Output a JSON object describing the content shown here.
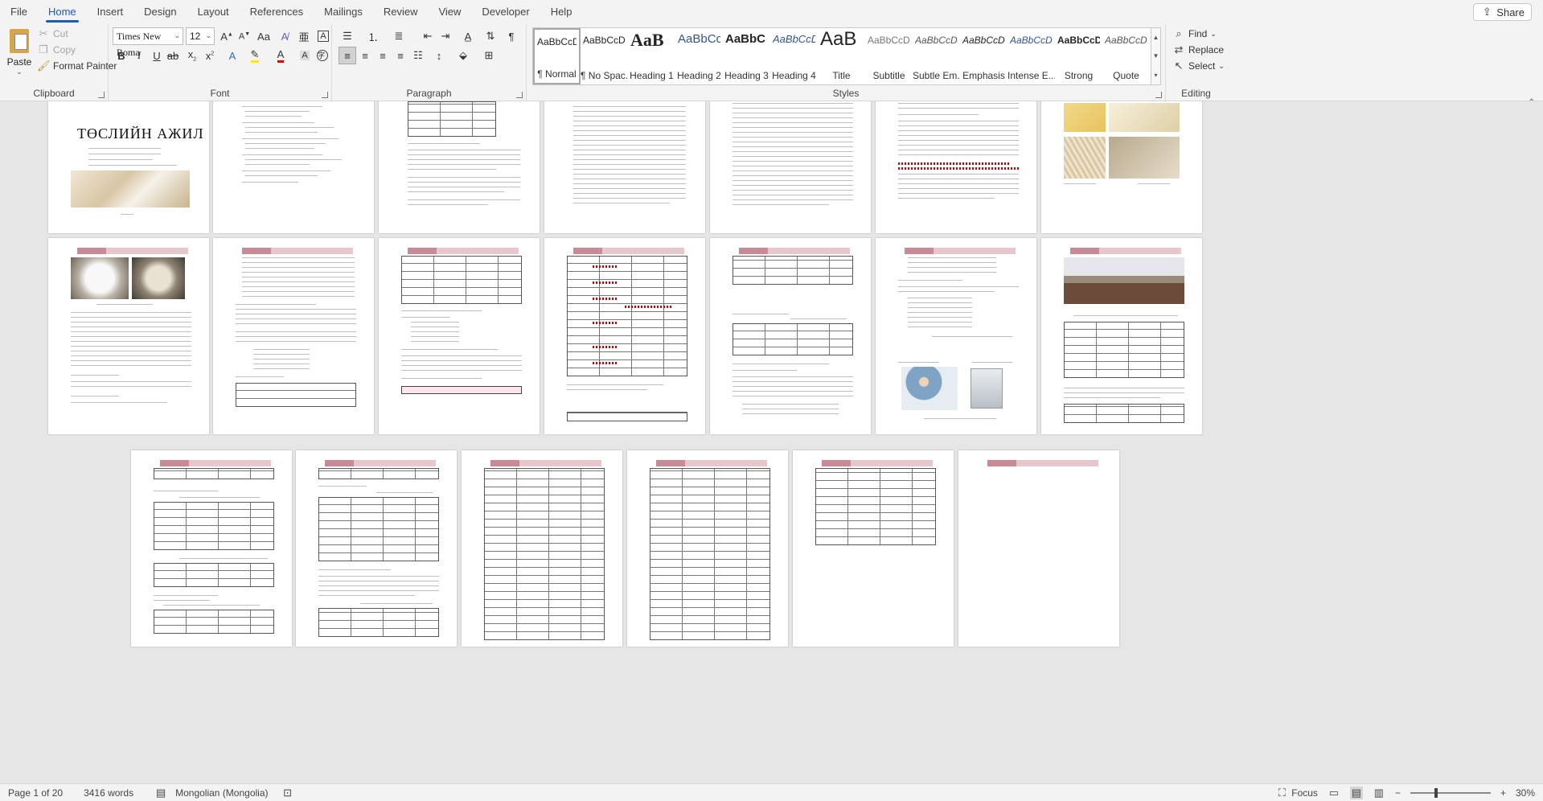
{
  "tabs": [
    "File",
    "Home",
    "Insert",
    "Design",
    "Layout",
    "References",
    "Mailings",
    "Review",
    "View",
    "Developer",
    "Help"
  ],
  "active_tab": "Home",
  "share_label": "Share",
  "clipboard": {
    "paste_label": "Paste",
    "cut_label": "Cut",
    "copy_label": "Copy",
    "format_painter_label": "Format Painter",
    "group_label": "Clipboard"
  },
  "font": {
    "font_name": "Times New Roma",
    "font_size": "12",
    "group_label": "Font"
  },
  "paragraph": {
    "group_label": "Paragraph"
  },
  "styles": {
    "group_label": "Styles",
    "items": [
      {
        "preview": "AaBbCcDc",
        "name": "¶ Normal"
      },
      {
        "preview": "AaBbCcDc",
        "name": "¶ No Spac..."
      },
      {
        "preview": "AaB",
        "name": "Heading 1"
      },
      {
        "preview": "AaBbCcl",
        "name": "Heading 2"
      },
      {
        "preview": "AaBbC",
        "name": "Heading 3"
      },
      {
        "preview": "AaBbCcD",
        "name": "Heading 4"
      },
      {
        "preview": "AaB",
        "name": "Title"
      },
      {
        "preview": "AaBbCcDc",
        "name": "Subtitle"
      },
      {
        "preview": "AaBbCcDc",
        "name": "Subtle Em..."
      },
      {
        "preview": "AaBbCcDc",
        "name": "Emphasis"
      },
      {
        "preview": "AaBbCcDc",
        "name": "Intense E..."
      },
      {
        "preview": "AaBbCcDc",
        "name": "Strong"
      },
      {
        "preview": "AaBbCcDc",
        "name": "Quote"
      }
    ]
  },
  "editing": {
    "group_label": "Editing",
    "find_label": "Find",
    "replace_label": "Replace",
    "select_label": "Select"
  },
  "document": {
    "cover_title": "ТӨСЛИЙН АЖИЛ"
  },
  "statusbar": {
    "page": "Page 1 of 20",
    "words": "3416 words",
    "language": "Mongolian (Mongolia)",
    "focus_label": "Focus",
    "zoom": "30%"
  },
  "colors": {
    "accent": "#185abd",
    "header_band": "#e7c6cc",
    "header_dark": "#c98a97"
  }
}
